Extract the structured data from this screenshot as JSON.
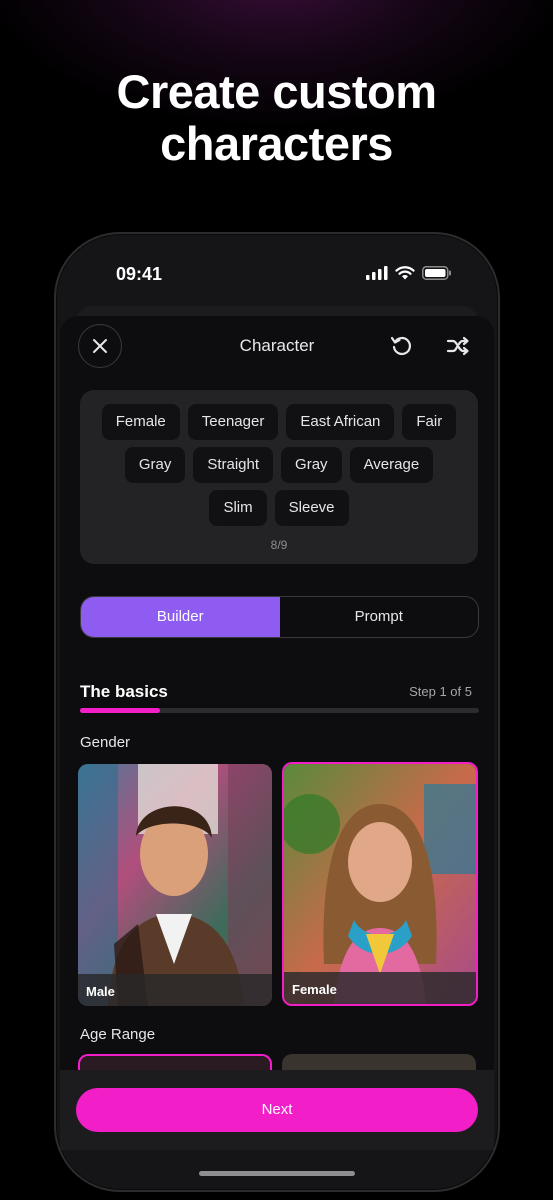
{
  "headline": {
    "line1": "Create custom",
    "line2": "characters"
  },
  "status_bar": {
    "time": "09:41"
  },
  "header": {
    "title": "Character"
  },
  "tags": {
    "rows": [
      [
        "Female",
        "Teenager",
        "East African",
        "Fair"
      ],
      [
        "Gray",
        "Straight",
        "Gray",
        "Average"
      ],
      [
        "Slim",
        "Sleeve"
      ]
    ],
    "count": "8/9"
  },
  "segment": {
    "builder": "Builder",
    "prompt": "Prompt",
    "active": "Builder"
  },
  "section": {
    "title": "The basics",
    "step": "Step 1 of 5",
    "progress": 0.2
  },
  "gender": {
    "label": "Gender",
    "options": [
      {
        "label": "Male",
        "selected": false
      },
      {
        "label": "Female",
        "selected": true
      }
    ]
  },
  "age_range": {
    "label": "Age Range"
  },
  "footer": {
    "next_label": "Next"
  },
  "colors": {
    "accent_pink": "#f21fc8",
    "accent_purple": "#8e5cf0"
  }
}
